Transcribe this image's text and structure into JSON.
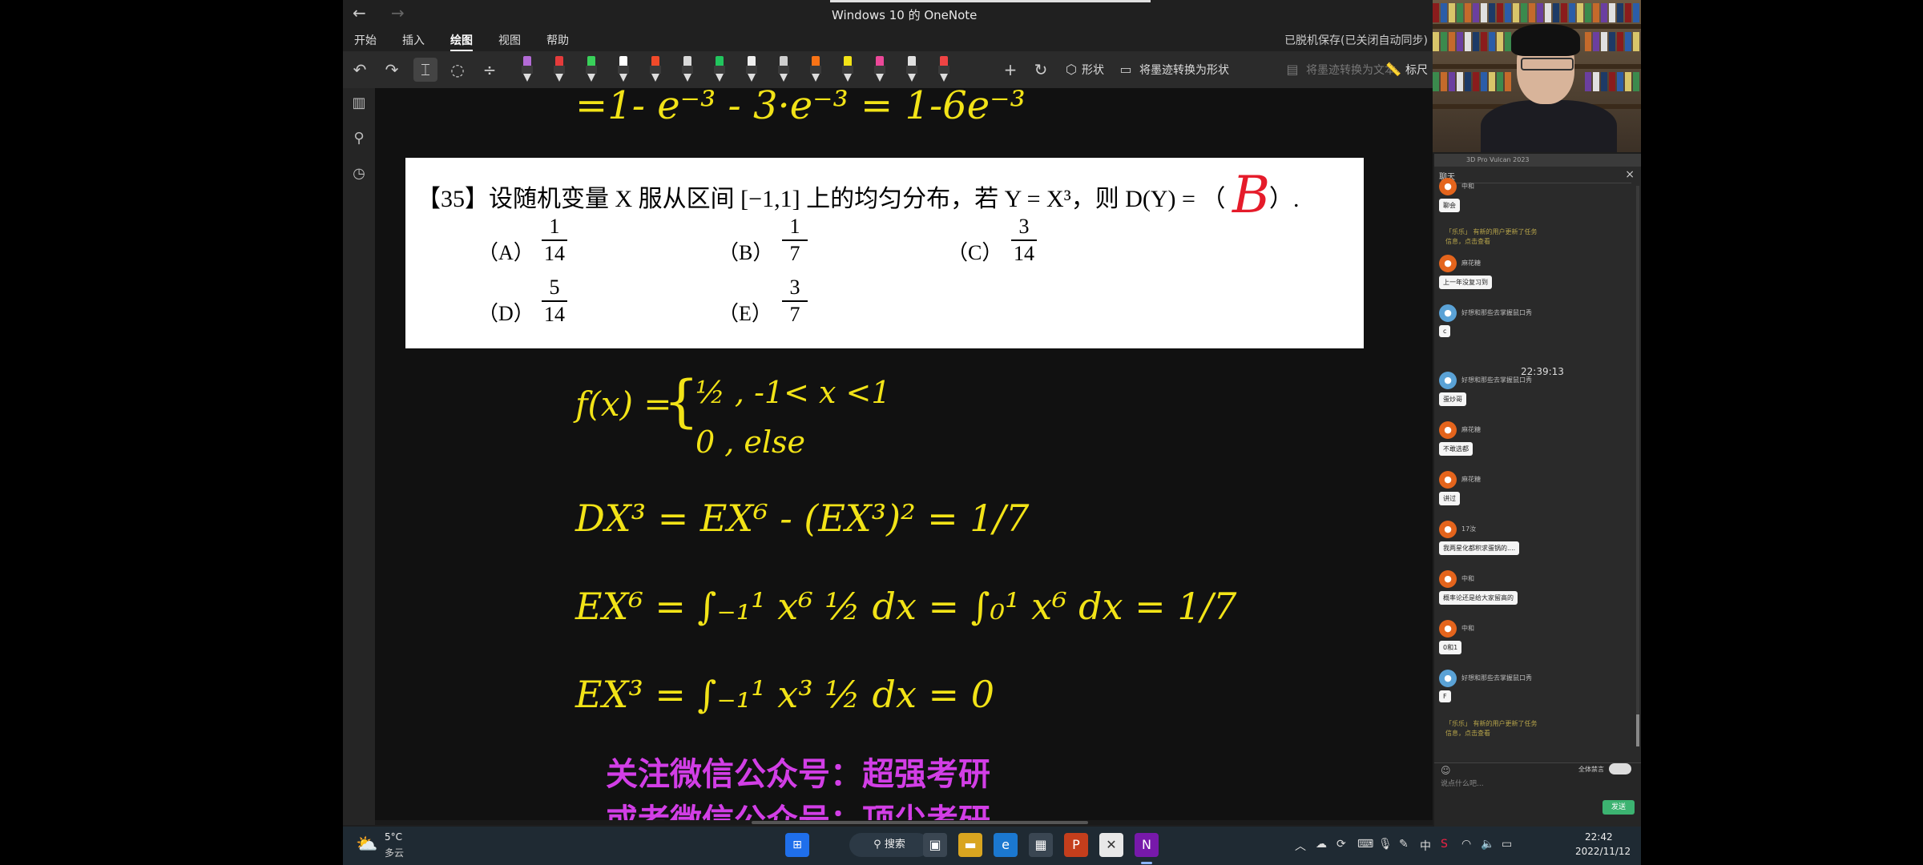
{
  "window": {
    "title": "Windows 10 的 OneNote",
    "status": "已脱机保存(已关闭自动同步)"
  },
  "menu": [
    "开始",
    "插入",
    "绘图",
    "视图",
    "帮助"
  ],
  "menu_active": "绘图",
  "toolbar": {
    "shapes_label": "形状",
    "ink_to_shape": "将墨迹转换为形状",
    "ink_to_text": "将墨迹转换为文本",
    "ruler": "标尺",
    "pen_colors": [
      "#b36bd6",
      "#e53b3b",
      "#39d15a",
      "#ffffff",
      "#f14a2a",
      "#d9d9d9",
      "#22c55e",
      "#eeeeee",
      "#cfcfcf",
      "#f97316",
      "#f2e317",
      "#ec4899",
      "#e0e0e0",
      "#ef4444"
    ]
  },
  "handwriting": {
    "top_line": "=1- e⁻³ - 3·e⁻³ = 1-6e⁻³",
    "fx_lhs": "f(x) =",
    "fx_case1": "½ ,  -1< x <1",
    "fx_case2": "0 ,  else",
    "dx_line": "DX³ =  EX⁶ - (EX³)² = 1/7",
    "ex6_line": "EX⁶ = ∫₋₁¹ x⁶ ½ dx = ∫₀¹ x⁶ dx = 1/7",
    "ex3_line": "EX³ = ∫₋₁¹ x³ ½ dx = 0"
  },
  "question": {
    "stem": "【35】设随机变量 X 服从区间 [−1,1] 上的均匀分布，若 Y = X³，则 D(Y) = （",
    "answer": "B",
    "tail": "）.",
    "options": [
      {
        "label": "（A）",
        "num": "1",
        "den": "14"
      },
      {
        "label": "（B）",
        "num": "1",
        "den": "7"
      },
      {
        "label": "（C）",
        "num": "3",
        "den": "14"
      },
      {
        "label": "（D）",
        "num": "5",
        "den": "14"
      },
      {
        "label": "（E）",
        "num": "3",
        "den": "7"
      }
    ]
  },
  "promo": [
    "关注微信公众号：超强考研",
    "或者微信公众号：顶尖考研"
  ],
  "chat": {
    "header": "3D Pro Vulcan 2023",
    "tab": "聊天",
    "messages": [
      {
        "name": "中和",
        "text": "聊会"
      },
      {
        "sys": "「乐乐」 有新的用户更新了任务",
        "sys2": "信息，点击查看"
      },
      {
        "name": "麻花糖",
        "text": "上一年没复习到"
      },
      {
        "name": "好想和那些去掌握鼠口秀",
        "text": "c",
        "blue": true
      },
      {
        "name": "好想和那些去掌握鼠口秀",
        "text": "蛋炒哥",
        "blue": true
      },
      {
        "name": "麻花糖",
        "text": "不敢选都"
      },
      {
        "name": "麻花糖",
        "text": "讲过"
      },
      {
        "name": "17汝",
        "text": "我两星化都积求蛋锅的...."
      },
      {
        "name": "中和",
        "text": "概率论还是给大家留高的"
      },
      {
        "name": "中和",
        "text": "0和1"
      },
      {
        "name": "好想和那些去掌握鼠口秀",
        "text": "F",
        "blue": true
      },
      {
        "sys": "「乐乐」 有新的用户更新了任务",
        "sys2": "信息，点击查看"
      }
    ],
    "timestamp": "22:39:13",
    "input_placeholder": "说点什么吧...",
    "mute_all": "全体禁言",
    "send": "发送"
  },
  "taskbar": {
    "weather_temp": "5°C",
    "weather_desc": "多云",
    "search": "搜索",
    "time": "22:42",
    "date": "2022/11/12",
    "ime": "中"
  }
}
